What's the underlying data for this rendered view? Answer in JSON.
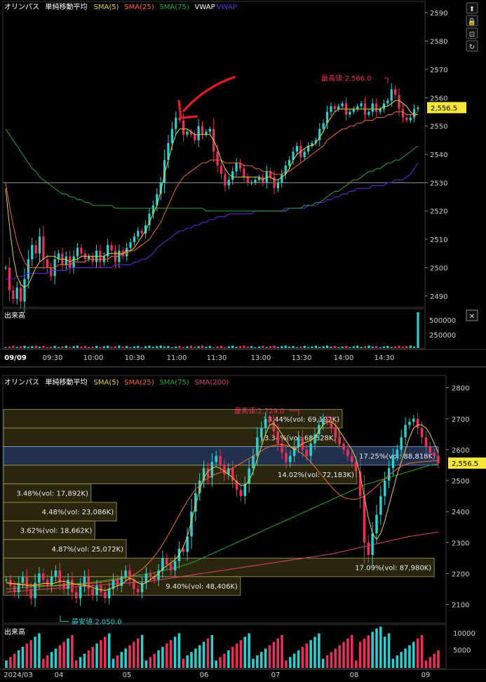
{
  "colors": {
    "bg": "#000000",
    "border": "#3a3a3a",
    "grid": "#2a2a2a",
    "axis_text": "#d0d0d0",
    "up": "#2ad0d0",
    "down": "#e8305a",
    "sma5": "#e6d23a",
    "sma25": "#f06a2a",
    "sma75": "#23a83a",
    "sma200": "#e0406a",
    "vwap": "#6a28f0",
    "annot": "#e8305a",
    "low_annot": "#2ad0d0",
    "price_tag": "#f5e63a",
    "arrow": "#d81e1e"
  },
  "top_panel": {
    "legend": [
      {
        "text": "オリンパス",
        "color": "#ffffff"
      },
      {
        "text": "単純移動平均",
        "color": "#ffffff"
      },
      {
        "text": "SMA(5)",
        "color": "#e6d23a"
      },
      {
        "text": "SMA(25)",
        "color": "#f06a2a"
      },
      {
        "text": "SMA(75)",
        "color": "#23a83a"
      },
      {
        "text": "VWAP",
        "color": "#ffffff"
      },
      {
        "text": "VWAP",
        "color": "#6a28f0"
      }
    ],
    "high_annotation": "最高値:2,566.0",
    "price_tag": "2,556.5",
    "volume_label": "出来高",
    "close_button": "✕",
    "icons": [
      "scroll-up-icon",
      "lock-icon",
      "unlock-icon",
      "refresh-icon"
    ]
  },
  "bottom_panel": {
    "legend": [
      {
        "text": "オリンパス",
        "color": "#ffffff"
      },
      {
        "text": "単純移動平均",
        "color": "#ffffff"
      },
      {
        "text": "SMA(5)",
        "color": "#e6d23a"
      },
      {
        "text": "SMA(25)",
        "color": "#f06a2a"
      },
      {
        "text": "SMA(75)",
        "color": "#23a83a"
      },
      {
        "text": "SMA(200)",
        "color": "#e0406a"
      }
    ],
    "high_annotation": "最高値:2,729.0",
    "low_annotation": "最安値:2,050.0",
    "price_tag": "2,556.5",
    "volume_label": "出来高"
  },
  "chart_data": [
    {
      "type": "candlestick",
      "title": "オリンパス",
      "interval": "intraday",
      "ylim": [
        2486,
        2594
      ],
      "yticks": [
        2490,
        2500,
        2510,
        2520,
        2530,
        2540,
        2550,
        2560,
        2570,
        2580,
        2590
      ],
      "x_ticks": [
        "09/09",
        "09:30",
        "10:00",
        "10:30",
        "11:00",
        "11:30",
        "13:00",
        "13:30",
        "14:00",
        "14:30"
      ],
      "reference_line": 2530,
      "last_price": 2556.5,
      "high": 2566.0,
      "closes": [
        2500,
        2492,
        2489,
        2493,
        2488,
        2496,
        2503,
        2508,
        2505,
        2511,
        2503,
        2500,
        2497,
        2503,
        2505,
        2501,
        2504,
        2500,
        2504,
        2507,
        2505,
        2503,
        2504,
        2502,
        2506,
        2502,
        2504,
        2508,
        2506,
        2502,
        2506,
        2504,
        2507,
        2509,
        2511,
        2513,
        2512,
        2515,
        2519,
        2522,
        2526,
        2530,
        2538,
        2544,
        2549,
        2553,
        2552,
        2547,
        2548,
        2547,
        2545,
        2550,
        2547,
        2548,
        2549,
        2541,
        2536,
        2533,
        2529,
        2531,
        2534,
        2537,
        2535,
        2532,
        2530,
        2530,
        2531,
        2532,
        2530,
        2534,
        2532,
        2528,
        2530,
        2533,
        2536,
        2538,
        2541,
        2543,
        2539,
        2541,
        2543,
        2544,
        2545,
        2549,
        2551,
        2555,
        2557,
        2556,
        2557,
        2558,
        2554,
        2555,
        2556,
        2557,
        2558,
        2554,
        2555,
        2558,
        2555,
        2556,
        2558,
        2559,
        2563,
        2561,
        2556,
        2553,
        2552,
        2553,
        2556,
        2556.5
      ],
      "sma5": [
        2528,
        2515,
        2504,
        2497,
        2494,
        2493,
        2494,
        2497,
        2500,
        2502,
        2503,
        2504,
        2504,
        2504,
        2503,
        2503,
        2503,
        2502,
        2503,
        2503,
        2504,
        2504,
        2504,
        2504,
        2504,
        2504,
        2504,
        2505,
        2505,
        2505,
        2505,
        2505,
        2506,
        2506,
        2507,
        2509,
        2511,
        2513,
        2516,
        2519,
        2522,
        2527,
        2533,
        2538,
        2543,
        2547,
        2549,
        2549,
        2549,
        2548,
        2547,
        2547,
        2547,
        2547,
        2547,
        2545,
        2542,
        2538,
        2535,
        2533,
        2532,
        2532,
        2532,
        2532,
        2532,
        2532,
        2532,
        2532,
        2531,
        2532,
        2532,
        2531,
        2531,
        2532,
        2533,
        2535,
        2538,
        2540,
        2541,
        2542,
        2543,
        2543,
        2544,
        2546,
        2548,
        2551,
        2553,
        2555,
        2556,
        2556,
        2556,
        2556,
        2556,
        2556,
        2556,
        2556,
        2556,
        2556,
        2556,
        2556,
        2557,
        2557,
        2558,
        2559,
        2559,
        2558,
        2557,
        2555,
        2554,
        2554
      ],
      "sma25": [
        2530,
        2522,
        2515,
        2509,
        2505,
        2502,
        2500,
        2500,
        2500,
        2500,
        2500,
        2500,
        2500,
        2500,
        2501,
        2501,
        2501,
        2501,
        2502,
        2502,
        2502,
        2502,
        2503,
        2503,
        2503,
        2503,
        2503,
        2503,
        2504,
        2504,
        2504,
        2505,
        2505,
        2506,
        2506,
        2507,
        2508,
        2509,
        2510,
        2512,
        2514,
        2516,
        2519,
        2522,
        2525,
        2528,
        2530,
        2532,
        2533,
        2534,
        2535,
        2536,
        2537,
        2537,
        2538,
        2538,
        2538,
        2538,
        2537,
        2537,
        2537,
        2537,
        2537,
        2536,
        2536,
        2536,
        2535,
        2535,
        2534,
        2534,
        2534,
        2533,
        2533,
        2533,
        2534,
        2534,
        2535,
        2536,
        2537,
        2538,
        2539,
        2540,
        2541,
        2542,
        2543,
        2545,
        2546,
        2547,
        2548,
        2549,
        2549,
        2550,
        2550,
        2551,
        2551,
        2552,
        2552,
        2552,
        2553,
        2553,
        2553,
        2554,
        2554,
        2555,
        2555,
        2555,
        2554,
        2554,
        2554,
        2555
      ],
      "sma75": [
        2549,
        2547,
        2545,
        2543,
        2541,
        2539,
        2537,
        2535,
        2534,
        2532,
        2531,
        2530,
        2529,
        2528,
        2527,
        2526,
        2526,
        2525,
        2525,
        2524,
        2524,
        2523,
        2523,
        2522,
        2522,
        2522,
        2522,
        2522,
        2522,
        2521,
        2521,
        2521,
        2521,
        2521,
        2521,
        2521,
        2521,
        2521,
        2521,
        2521,
        2521,
        2521,
        2521,
        2521,
        2521,
        2521,
        2521,
        2521,
        2521,
        2521,
        2521,
        2521,
        2521,
        2520,
        2520,
        2520,
        2520,
        2520,
        2520,
        2520,
        2520,
        2520,
        2520,
        2520,
        2520,
        2520,
        2520,
        2520,
        2520,
        2520,
        2520,
        2520,
        2520,
        2520,
        2520,
        2521,
        2521,
        2521,
        2521,
        2522,
        2522,
        2522,
        2523,
        2523,
        2524,
        2525,
        2526,
        2527,
        2527,
        2528,
        2529,
        2530,
        2531,
        2531,
        2532,
        2533,
        2534,
        2534,
        2535,
        2535,
        2536,
        2537,
        2537,
        2538,
        2538,
        2539,
        2540,
        2541,
        2542,
        2543
      ],
      "vwap": [
        2496,
        2496,
        2496,
        2497,
        2497,
        2497,
        2498,
        2498,
        2498,
        2498,
        2498,
        2498,
        2499,
        2499,
        2499,
        2499,
        2499,
        2500,
        2500,
        2500,
        2500,
        2500,
        2500,
        2500,
        2500,
        2500,
        2500,
        2500,
        2500,
        2501,
        2501,
        2501,
        2501,
        2501,
        2502,
        2502,
        2503,
        2503,
        2504,
        2505,
        2507,
        2508,
        2509,
        2510,
        2511,
        2512,
        2513,
        2513,
        2514,
        2514,
        2515,
        2515,
        2516,
        2516,
        2517,
        2517,
        2518,
        2518,
        2518,
        2519,
        2519,
        2519,
        2519,
        2519,
        2519,
        2519,
        2520,
        2520,
        2520,
        2520,
        2520,
        2520,
        2520,
        2520,
        2521,
        2521,
        2521,
        2521,
        2521,
        2521,
        2522,
        2522,
        2522,
        2523,
        2523,
        2524,
        2524,
        2525,
        2525,
        2526,
        2526,
        2527,
        2527,
        2528,
        2528,
        2528,
        2528,
        2529,
        2529,
        2529,
        2529,
        2530,
        2530,
        2531,
        2531,
        2531,
        2532,
        2533,
        2535,
        2537
      ],
      "volume_axis": [
        "500000",
        "250000"
      ],
      "volume_last": 530000
    },
    {
      "type": "candlestick",
      "title": "オリンパス",
      "interval": "daily",
      "ylim": [
        2040,
        2840
      ],
      "yticks": [
        2100,
        2200,
        2300,
        2400,
        2500,
        2600,
        2700,
        2800
      ],
      "x_ticks": [
        "2024/03",
        "04",
        "05",
        "06",
        "07",
        "08",
        "09"
      ],
      "last_price": 2556.5,
      "high": 2729.0,
      "low": 2050.0,
      "closes": [
        2180,
        2160,
        2140,
        2170,
        2190,
        2150,
        2120,
        2170,
        2200,
        2180,
        2160,
        2190,
        2210,
        2170,
        2150,
        2180,
        2140,
        2120,
        2160,
        2190,
        2150,
        2130,
        2160,
        2140,
        2120,
        2150,
        2180,
        2160,
        2190,
        2210,
        2180,
        2150,
        2140,
        2170,
        2200,
        2190,
        2180,
        2210,
        2250,
        2230,
        2210,
        2240,
        2280,
        2270,
        2320,
        2400,
        2460,
        2500,
        2540,
        2510,
        2560,
        2580,
        2550,
        2520,
        2540,
        2500,
        2470,
        2450,
        2490,
        2540,
        2580,
        2640,
        2670,
        2700,
        2690,
        2660,
        2620,
        2590,
        2560,
        2580,
        2610,
        2640,
        2600,
        2580,
        2620,
        2650,
        2680,
        2700,
        2690,
        2670,
        2640,
        2620,
        2600,
        2580,
        2560,
        2530,
        2450,
        2300,
        2260,
        2330,
        2390,
        2450,
        2500,
        2540,
        2580,
        2600,
        2640,
        2680,
        2690,
        2700,
        2670,
        2640,
        2610,
        2590,
        2580,
        2556.5
      ],
      "sma5": [
        2170,
        2168,
        2166,
        2165,
        2163,
        2162,
        2160,
        2162,
        2165,
        2168,
        2168,
        2167,
        2170,
        2175,
        2175,
        2172,
        2168,
        2165,
        2163,
        2162,
        2160,
        2155,
        2150,
        2148,
        2145,
        2150,
        2155,
        2160,
        2165,
        2175,
        2185,
        2180,
        2170,
        2165,
        2170,
        2180,
        2190,
        2200,
        2215,
        2225,
        2235,
        2245,
        2260,
        2285,
        2320,
        2370,
        2420,
        2470,
        2510,
        2530,
        2540,
        2545,
        2540,
        2530,
        2520,
        2510,
        2495,
        2485,
        2485,
        2500,
        2530,
        2570,
        2610,
        2650,
        2680,
        2685,
        2670,
        2650,
        2630,
        2610,
        2600,
        2610,
        2620,
        2625,
        2630,
        2640,
        2660,
        2680,
        2690,
        2690,
        2680,
        2660,
        2640,
        2620,
        2600,
        2570,
        2520,
        2450,
        2380,
        2330,
        2310,
        2330,
        2370,
        2420,
        2470,
        2520,
        2560,
        2600,
        2640,
        2670,
        2680,
        2680,
        2670,
        2650,
        2620,
        2590
      ],
      "sma25": [
        2170,
        2169,
        2168,
        2167,
        2166,
        2165,
        2164,
        2163,
        2162,
        2161,
        2160,
        2160,
        2160,
        2161,
        2162,
        2163,
        2164,
        2165,
        2166,
        2167,
        2168,
        2169,
        2170,
        2172,
        2174,
        2176,
        2178,
        2180,
        2183,
        2186,
        2190,
        2196,
        2204,
        2214,
        2226,
        2240,
        2256,
        2274,
        2294,
        2316,
        2340,
        2364,
        2388,
        2412,
        2434,
        2454,
        2472,
        2486,
        2498,
        2508,
        2516,
        2522,
        2526,
        2530,
        2534,
        2540,
        2548,
        2556,
        2564,
        2572,
        2580,
        2588,
        2596,
        2604,
        2610,
        2614,
        2616,
        2616,
        2614,
        2610,
        2604,
        2596,
        2586,
        2574,
        2560,
        2544,
        2528,
        2512,
        2496,
        2480,
        2466,
        2454,
        2446,
        2442,
        2440,
        2440,
        2444,
        2450,
        2460,
        2470,
        2482,
        2494,
        2506,
        2518,
        2528,
        2538,
        2546,
        2552,
        2556,
        2558,
        2560,
        2561,
        2562,
        2563,
        2564,
        2565
      ],
      "sma75": [
        2150,
        2151,
        2152,
        2153,
        2154,
        2155,
        2156,
        2157,
        2158,
        2159,
        2160,
        2161,
        2162,
        2163,
        2164,
        2165,
        2166,
        2167,
        2168,
        2169,
        2170,
        2172,
        2174,
        2176,
        2178,
        2180,
        2182,
        2184,
        2186,
        2188,
        2190,
        2192,
        2194,
        2196,
        2198,
        2200,
        2203,
        2206,
        2209,
        2212,
        2215,
        2218,
        2222,
        2226,
        2230,
        2235,
        2240,
        2246,
        2252,
        2258,
        2264,
        2270,
        2276,
        2282,
        2288,
        2294,
        2300,
        2306,
        2312,
        2318,
        2324,
        2330,
        2336,
        2342,
        2348,
        2354,
        2360,
        2366,
        2372,
        2378,
        2384,
        2390,
        2396,
        2402,
        2408,
        2414,
        2420,
        2426,
        2432,
        2438,
        2444,
        2450,
        2456,
        2462,
        2468,
        2474,
        2480,
        2486,
        2490,
        2494,
        2498,
        2502,
        2506,
        2510,
        2514,
        2518,
        2522,
        2526,
        2530,
        2534,
        2538,
        2542,
        2546,
        2550,
        2552,
        2554
      ],
      "sma200": [
        2140,
        2141,
        2142,
        2143,
        2144,
        2145,
        2146,
        2147,
        2148,
        2149,
        2150,
        2151,
        2152,
        2153,
        2154,
        2155,
        2156,
        2157,
        2158,
        2159,
        2160,
        2161,
        2162,
        2163,
        2164,
        2165,
        2166,
        2167,
        2168,
        2169,
        2170,
        2171,
        2172,
        2173,
        2174,
        2175,
        2177,
        2179,
        2181,
        2183,
        2185,
        2187,
        2189,
        2191,
        2193,
        2195,
        2197,
        2199,
        2201,
        2203,
        2205,
        2207,
        2209,
        2211,
        2213,
        2215,
        2217,
        2219,
        2221,
        2223,
        2225,
        2227,
        2229,
        2231,
        2233,
        2235,
        2237,
        2239,
        2241,
        2243,
        2245,
        2247,
        2249,
        2251,
        2253,
        2255,
        2257,
        2259,
        2261,
        2263,
        2266,
        2269,
        2272,
        2275,
        2278,
        2281,
        2284,
        2287,
        2290,
        2293,
        2296,
        2299,
        2302,
        2305,
        2308,
        2311,
        2314,
        2317,
        2320,
        2322,
        2324,
        2326,
        2328,
        2330,
        2332,
        2334
      ],
      "volume_profile": [
        {
          "label": "13.44%(vol: 69,197K)",
          "low": 2670,
          "high": 2730
        },
        {
          "label": "13.34%(vol: 68,528K)",
          "low": 2610,
          "high": 2670
        },
        {
          "label": "17.25%(vol: 88,818K)",
          "low": 2550,
          "high": 2610
        },
        {
          "label": "14.02%(vol: 72,183K)",
          "low": 2490,
          "high": 2550
        },
        {
          "label": "3.48%(vol: 17,892K)",
          "low": 2430,
          "high": 2490
        },
        {
          "label": "4.48%(vol: 23,086K)",
          "low": 2370,
          "high": 2430
        },
        {
          "label": "3.62%(vol: 18,662K)",
          "low": 2310,
          "high": 2370
        },
        {
          "label": "4.87%(vol: 25,072K)",
          "low": 2250,
          "high": 2310
        },
        {
          "label": "17.09%(vol: 87,980K)",
          "low": 2190,
          "high": 2250
        },
        {
          "label": "9.40%(vol: 48,406K)",
          "low": 2130,
          "high": 2190
        }
      ],
      "volume_axis": [
        "10000",
        "5000"
      ]
    }
  ]
}
